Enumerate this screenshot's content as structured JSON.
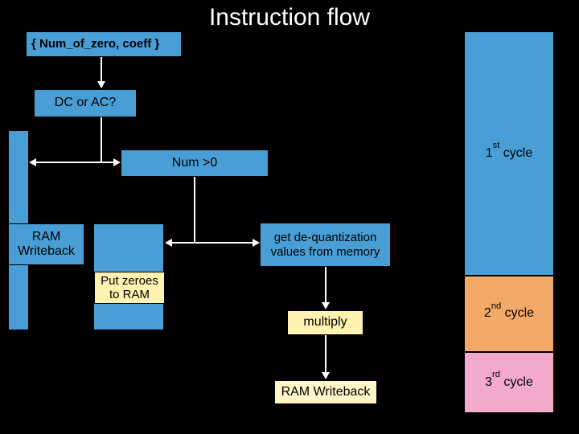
{
  "title": "Instruction flow",
  "nodes": {
    "input": "{ Num_of_zero, coeff }",
    "decision": "DC or AC?",
    "num_gt_zero": "Num >0",
    "ram_writeback_left": "RAM Writeback",
    "put_zeroes": "Put zeroes to RAM",
    "get_dequant": "get de-quantization values from memory",
    "multiply": "multiply",
    "ram_writeback_bottom": "RAM Writeback"
  },
  "cycles": {
    "first_html": "1<sup>st</sup> cycle",
    "second_html": "2<sup>nd</sup> cycle",
    "third_html": "3<sup>rd</sup> cycle"
  },
  "colors": {
    "node_blue": "#4a9ed6",
    "node_yellow": "#fff2b0",
    "cycle1": "#4a9ed6",
    "cycle2": "#f2a968",
    "cycle3": "#f3a9cc"
  }
}
